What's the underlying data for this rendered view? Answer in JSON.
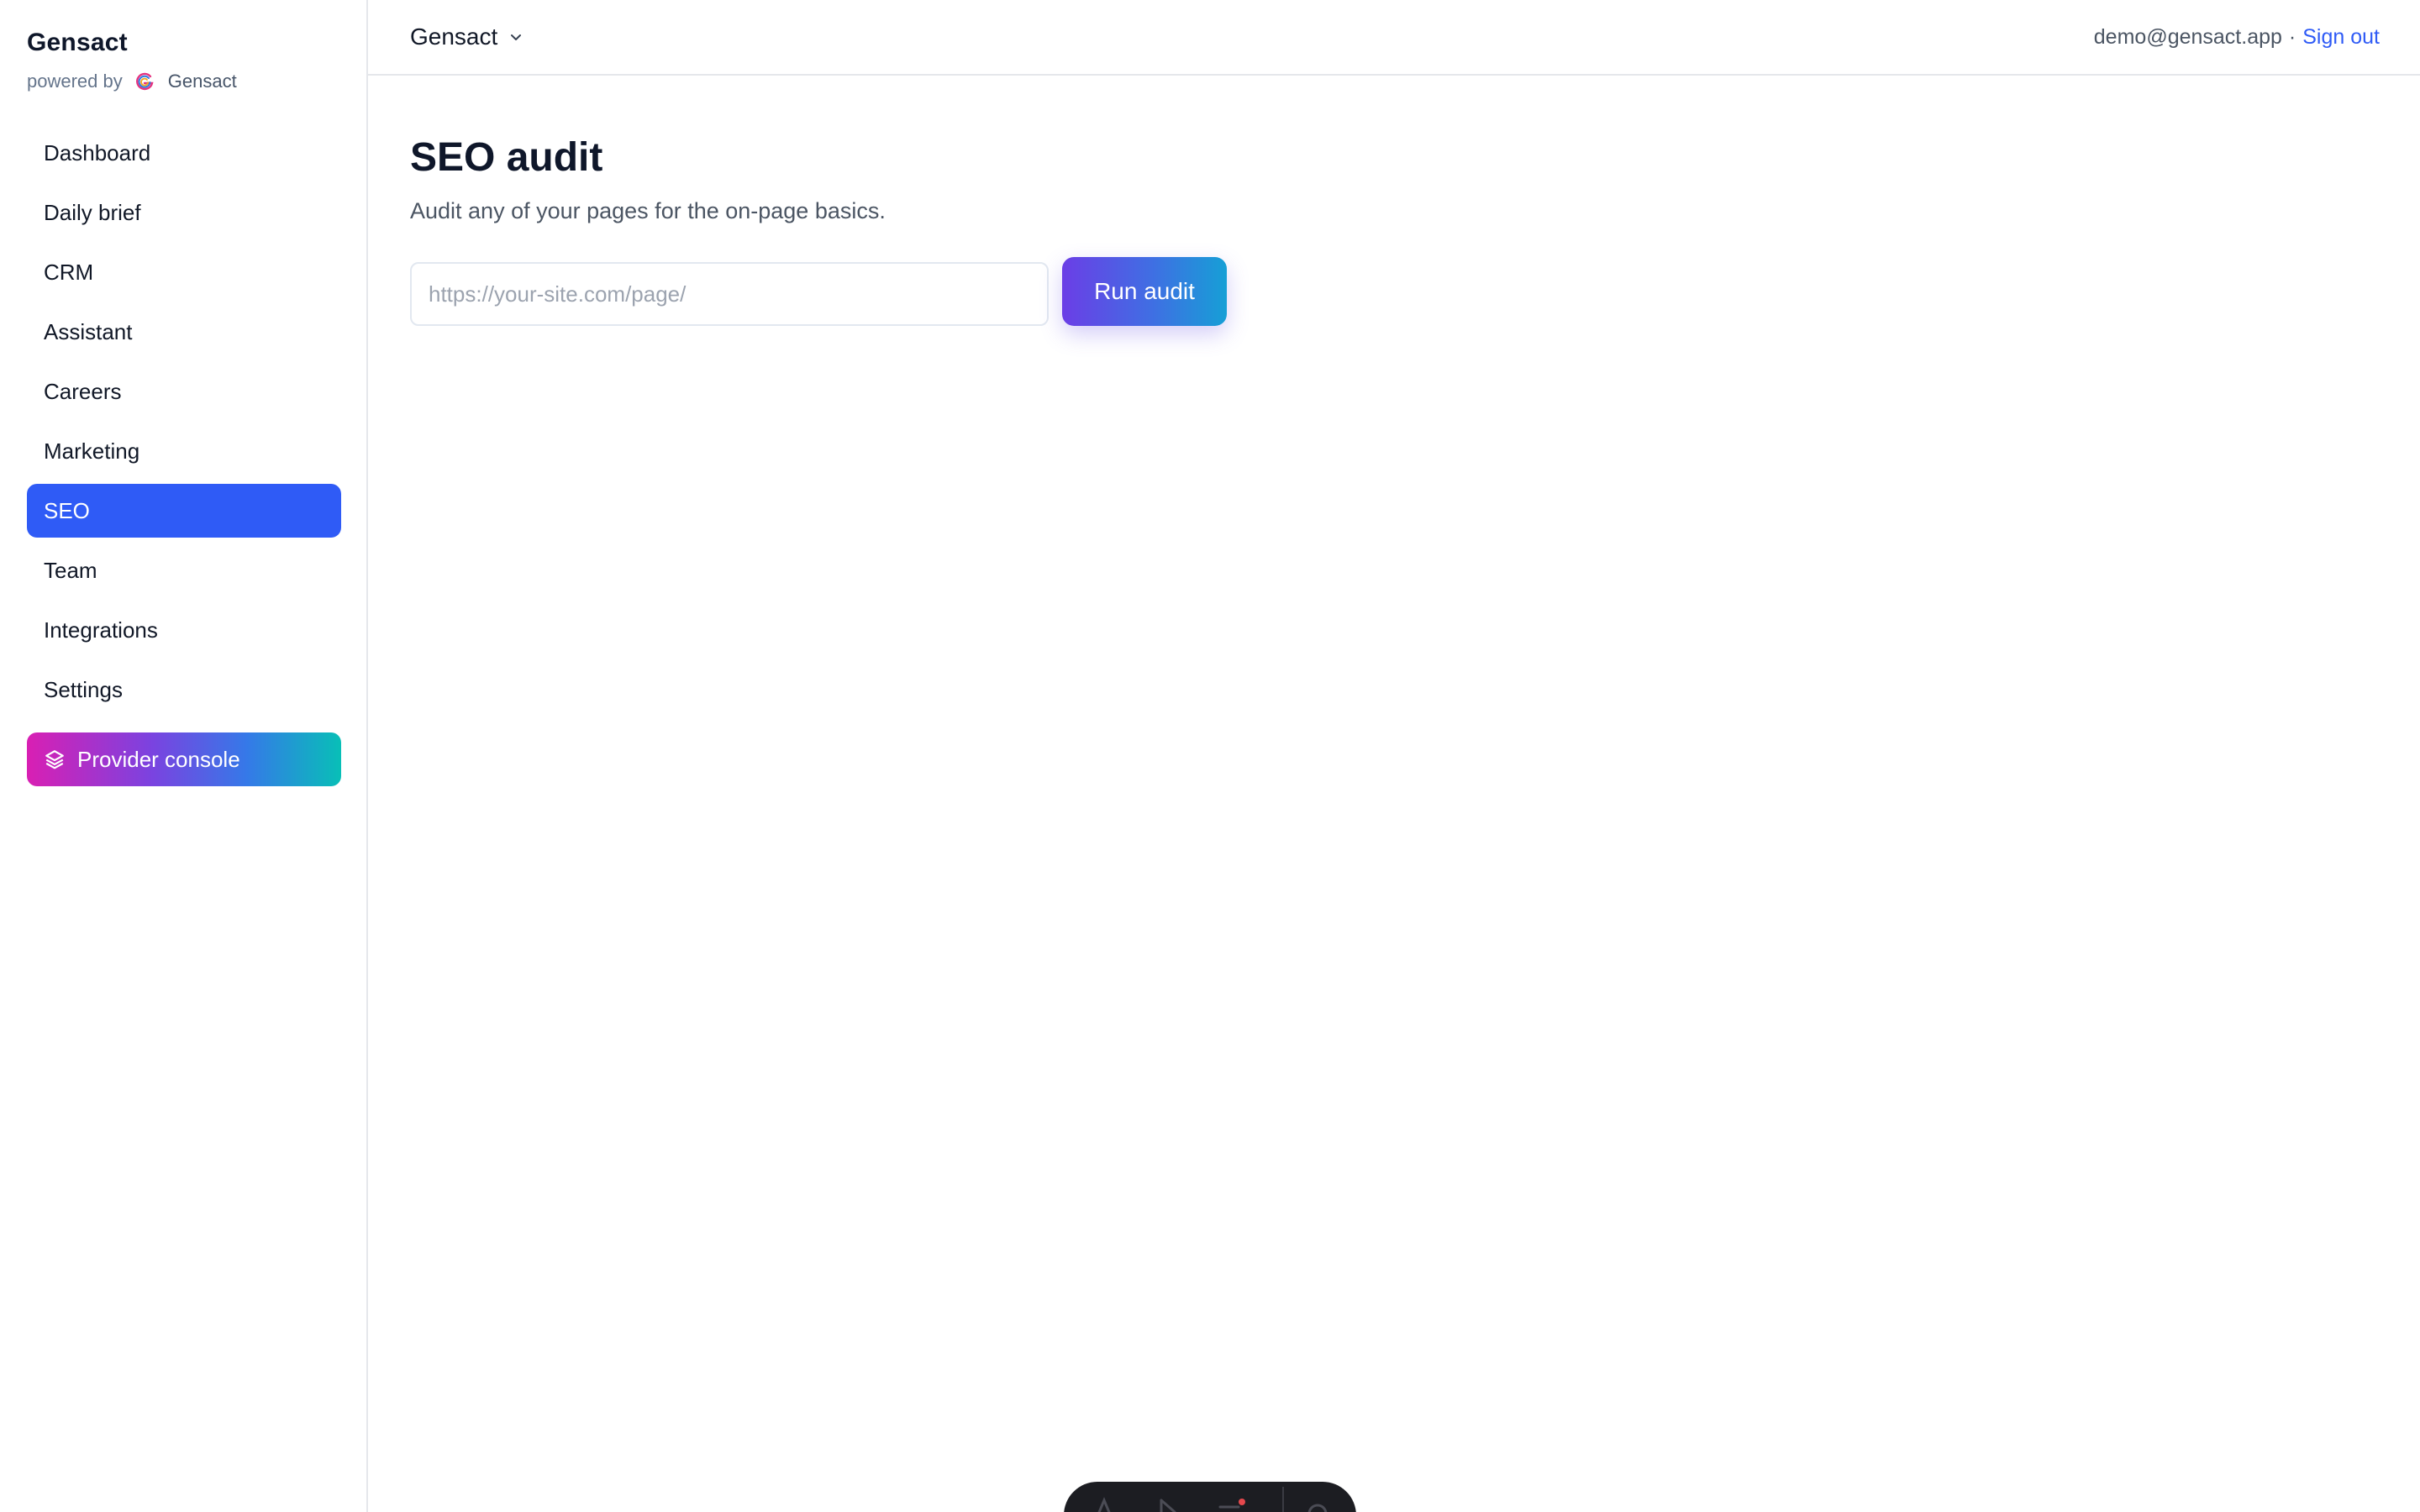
{
  "sidebar": {
    "brand_title": "Gensact",
    "powered_by_label": "powered by",
    "powered_by_name": "Gensact",
    "items": [
      {
        "label": "Dashboard"
      },
      {
        "label": "Daily brief"
      },
      {
        "label": "CRM"
      },
      {
        "label": "Assistant"
      },
      {
        "label": "Careers"
      },
      {
        "label": "Marketing"
      },
      {
        "label": "SEO",
        "active": true
      },
      {
        "label": "Team"
      },
      {
        "label": "Integrations"
      },
      {
        "label": "Settings"
      }
    ],
    "provider_console_label": "Provider console"
  },
  "header": {
    "workspace_name": "Gensact",
    "account_email": "demo@gensact.app",
    "separator": "·",
    "sign_out_label": "Sign out"
  },
  "main": {
    "title": "SEO audit",
    "subtitle": "Audit any of your pages for the on-page basics.",
    "url_input": {
      "value": "",
      "placeholder": "https://your-site.com/page/"
    },
    "run_button_label": "Run audit"
  },
  "icons": {
    "brand_logo": "gensact-logo-icon",
    "workspace_switch": "chevron-down-icon",
    "provider_console": "layers-icon",
    "dock": [
      "text-tool-icon",
      "pointer-icon",
      "menu-icon",
      "settings-icon"
    ]
  },
  "colors": {
    "accent": "#2f5bf6",
    "active_nav_bg": "#2f5bf6",
    "run_button_gradient": [
      "#6b3ee6",
      "#169fd6"
    ],
    "provider_gradient": [
      "#d91fb3",
      "#7a43e0",
      "#3579e8",
      "#08bfb7"
    ],
    "dock_bg": "#1c1d22"
  }
}
